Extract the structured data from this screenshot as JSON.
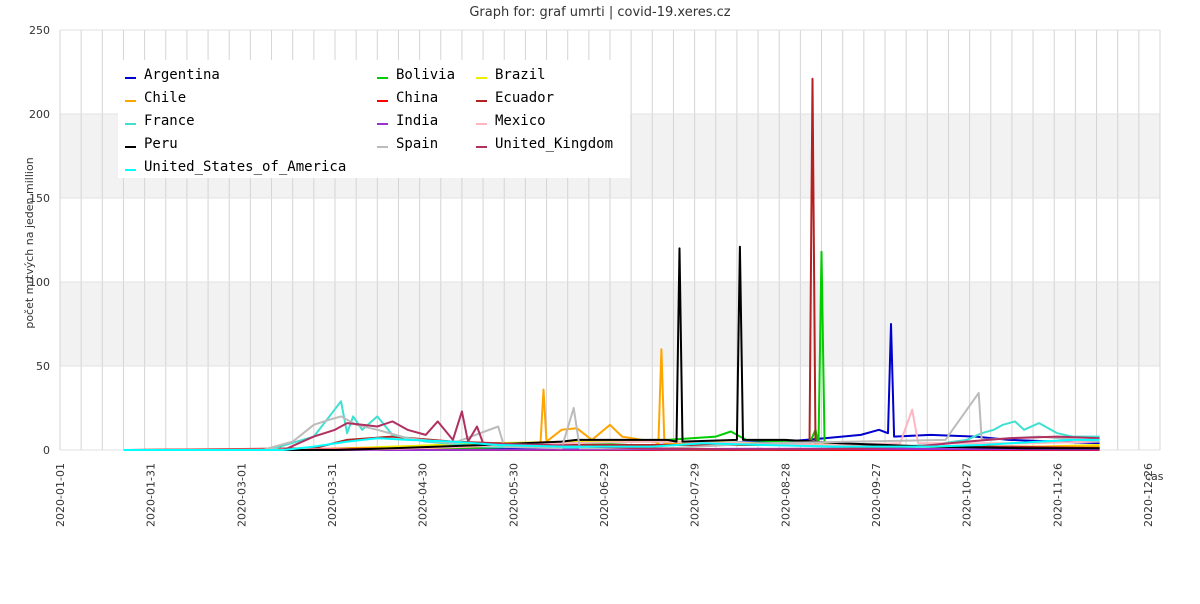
{
  "chart_data": {
    "type": "line",
    "title": "Graph for: graf umrti | covid-19.xeres.cz",
    "xlabel": "cas",
    "ylabel": "počet mrtvých na jeden million",
    "ylim": [
      0,
      250
    ],
    "xlim": [
      "2020-01-01",
      "2020-12-30"
    ],
    "grid": true,
    "legend_position": "top-left",
    "y_ticks": [
      0,
      50,
      100,
      150,
      200,
      250
    ],
    "x_ticks": [
      "2020-01-01",
      "2020-01-31",
      "2020-03-01",
      "2020-03-31",
      "2020-04-30",
      "2020-05-30",
      "2020-06-29",
      "2020-07-29",
      "2020-08-28",
      "2020-09-27",
      "2020-10-27",
      "2020-11-26",
      "2020-12-26"
    ],
    "series": [
      {
        "name": "Argentina",
        "color": "#0000cc",
        "points": [
          [
            "2020-01-22",
            0
          ],
          [
            "2020-03-09",
            0
          ],
          [
            "2020-04-01",
            0.3
          ],
          [
            "2020-05-01",
            0.5
          ],
          [
            "2020-06-01",
            1
          ],
          [
            "2020-07-01",
            2
          ],
          [
            "2020-08-01",
            4
          ],
          [
            "2020-08-28",
            5
          ],
          [
            "2020-09-10",
            7
          ],
          [
            "2020-09-22",
            9
          ],
          [
            "2020-09-28",
            12
          ],
          [
            "2020-10-01",
            10
          ],
          [
            "2020-10-02",
            75
          ],
          [
            "2020-10-03",
            8
          ],
          [
            "2020-10-15",
            9
          ],
          [
            "2020-10-30",
            8
          ],
          [
            "2020-11-10",
            6
          ],
          [
            "2020-11-26",
            5
          ],
          [
            "2020-12-10",
            4
          ]
        ]
      },
      {
        "name": "Bolivia",
        "color": "#00cc00",
        "points": [
          [
            "2020-01-22",
            0
          ],
          [
            "2020-04-01",
            0
          ],
          [
            "2020-05-15",
            1
          ],
          [
            "2020-06-20",
            3
          ],
          [
            "2020-07-20",
            6
          ],
          [
            "2020-08-05",
            8
          ],
          [
            "2020-08-10",
            11
          ],
          [
            "2020-08-15",
            6
          ],
          [
            "2020-09-05",
            4
          ],
          [
            "2020-09-07",
            12
          ],
          [
            "2020-09-08",
            3
          ],
          [
            "2020-09-09",
            118
          ],
          [
            "2020-09-10",
            3
          ],
          [
            "2020-10-15",
            2
          ],
          [
            "2020-12-10",
            1
          ]
        ]
      },
      {
        "name": "Brazil",
        "color": "#eeee00",
        "points": [
          [
            "2020-01-22",
            0
          ],
          [
            "2020-03-20",
            0
          ],
          [
            "2020-04-20",
            2
          ],
          [
            "2020-05-20",
            4
          ],
          [
            "2020-06-20",
            5
          ],
          [
            "2020-07-20",
            5
          ],
          [
            "2020-08-20",
            4
          ],
          [
            "2020-09-20",
            3
          ],
          [
            "2020-10-20",
            2
          ],
          [
            "2020-11-20",
            2
          ],
          [
            "2020-12-10",
            3
          ]
        ]
      },
      {
        "name": "Chile",
        "color": "#ffa500",
        "points": [
          [
            "2020-01-22",
            0
          ],
          [
            "2020-04-01",
            0
          ],
          [
            "2020-05-01",
            1
          ],
          [
            "2020-06-01",
            3
          ],
          [
            "2020-06-08",
            4
          ],
          [
            "2020-06-09",
            36
          ],
          [
            "2020-06-10",
            5
          ],
          [
            "2020-06-15",
            12
          ],
          [
            "2020-06-20",
            13
          ],
          [
            "2020-06-25",
            6
          ],
          [
            "2020-07-01",
            15
          ],
          [
            "2020-07-05",
            8
          ],
          [
            "2020-07-15",
            5
          ],
          [
            "2020-07-17",
            4
          ],
          [
            "2020-07-18",
            60
          ],
          [
            "2020-07-19",
            4
          ],
          [
            "2020-08-15",
            3
          ],
          [
            "2020-09-15",
            3
          ],
          [
            "2020-10-15",
            2
          ],
          [
            "2020-11-15",
            2
          ],
          [
            "2020-12-10",
            2
          ]
        ]
      },
      {
        "name": "China",
        "color": "#ff0000",
        "points": [
          [
            "2020-01-22",
            0
          ],
          [
            "2020-04-17",
            0.9
          ],
          [
            "2020-04-18",
            0
          ],
          [
            "2020-12-10",
            0
          ]
        ]
      },
      {
        "name": "Ecuador",
        "color": "#b22222",
        "points": [
          [
            "2020-01-22",
            0
          ],
          [
            "2020-03-25",
            1
          ],
          [
            "2020-04-05",
            6
          ],
          [
            "2020-04-20",
            8
          ],
          [
            "2020-05-10",
            5
          ],
          [
            "2020-06-10",
            3
          ],
          [
            "2020-07-10",
            3
          ],
          [
            "2020-08-10",
            3
          ],
          [
            "2020-09-05",
            3
          ],
          [
            "2020-09-06",
            221
          ],
          [
            "2020-09-07",
            3
          ],
          [
            "2020-10-10",
            2
          ],
          [
            "2020-11-10",
            2
          ],
          [
            "2020-12-10",
            1
          ]
        ]
      },
      {
        "name": "France",
        "color": "#40e0d0",
        "points": [
          [
            "2020-01-22",
            0
          ],
          [
            "2020-03-10",
            0
          ],
          [
            "2020-03-25",
            8
          ],
          [
            "2020-04-03",
            29
          ],
          [
            "2020-04-05",
            10
          ],
          [
            "2020-04-07",
            20
          ],
          [
            "2020-04-10",
            12
          ],
          [
            "2020-04-15",
            20
          ],
          [
            "2020-04-20",
            9
          ],
          [
            "2020-05-01",
            5
          ],
          [
            "2020-05-20",
            2
          ],
          [
            "2020-06-20",
            1
          ],
          [
            "2020-07-20",
            0.5
          ],
          [
            "2020-08-20",
            0.5
          ],
          [
            "2020-09-20",
            1
          ],
          [
            "2020-10-15",
            3
          ],
          [
            "2020-10-27",
            6
          ],
          [
            "2020-11-01",
            10
          ],
          [
            "2020-11-05",
            12
          ],
          [
            "2020-11-08",
            15
          ],
          [
            "2020-11-12",
            17
          ],
          [
            "2020-11-15",
            12
          ],
          [
            "2020-11-20",
            16
          ],
          [
            "2020-11-26",
            10
          ],
          [
            "2020-12-01",
            8
          ],
          [
            "2020-12-10",
            8
          ]
        ]
      },
      {
        "name": "India",
        "color": "#9932cc",
        "points": [
          [
            "2020-01-22",
            0
          ],
          [
            "2020-05-01",
            0
          ],
          [
            "2020-06-01",
            0.2
          ],
          [
            "2020-07-01",
            0.3
          ],
          [
            "2020-08-01",
            0.6
          ],
          [
            "2020-09-01",
            0.8
          ],
          [
            "2020-10-01",
            0.8
          ],
          [
            "2020-11-01",
            0.5
          ],
          [
            "2020-12-10",
            0.3
          ]
        ]
      },
      {
        "name": "Mexico",
        "color": "#ffb6c1",
        "points": [
          [
            "2020-01-22",
            0
          ],
          [
            "2020-04-15",
            0.5
          ],
          [
            "2020-05-15",
            2
          ],
          [
            "2020-06-15",
            4
          ],
          [
            "2020-07-15",
            5
          ],
          [
            "2020-08-15",
            4
          ],
          [
            "2020-09-15",
            3
          ],
          [
            "2020-10-05",
            4
          ],
          [
            "2020-10-09",
            24
          ],
          [
            "2020-10-11",
            4
          ],
          [
            "2020-11-15",
            4
          ],
          [
            "2020-12-10",
            5
          ]
        ]
      },
      {
        "name": "Peru",
        "color": "#000000",
        "points": [
          [
            "2020-01-22",
            0
          ],
          [
            "2020-04-01",
            0
          ],
          [
            "2020-04-20",
            1
          ],
          [
            "2020-05-20",
            3
          ],
          [
            "2020-06-15",
            5
          ],
          [
            "2020-06-20",
            6
          ],
          [
            "2020-07-20",
            6
          ],
          [
            "2020-07-23",
            5
          ],
          [
            "2020-07-24",
            120
          ],
          [
            "2020-07-25",
            5
          ],
          [
            "2020-08-12",
            6
          ],
          [
            "2020-08-13",
            121
          ],
          [
            "2020-08-14",
            6
          ],
          [
            "2020-08-28",
            6
          ],
          [
            "2020-09-15",
            4
          ],
          [
            "2020-10-15",
            2
          ],
          [
            "2020-11-15",
            1
          ],
          [
            "2020-12-10",
            1
          ]
        ]
      },
      {
        "name": "Spain",
        "color": "#bbbbbb",
        "points": [
          [
            "2020-01-22",
            0
          ],
          [
            "2020-03-08",
            0
          ],
          [
            "2020-03-18",
            5
          ],
          [
            "2020-03-25",
            15
          ],
          [
            "2020-03-30",
            18
          ],
          [
            "2020-04-03",
            20
          ],
          [
            "2020-04-08",
            15
          ],
          [
            "2020-04-15",
            12
          ],
          [
            "2020-04-25",
            7
          ],
          [
            "2020-05-10",
            4
          ],
          [
            "2020-05-25",
            14
          ],
          [
            "2020-05-27",
            2
          ],
          [
            "2020-06-15",
            1
          ],
          [
            "2020-06-19",
            25
          ],
          [
            "2020-06-21",
            1
          ],
          [
            "2020-07-20",
            1
          ],
          [
            "2020-08-20",
            4
          ],
          [
            "2020-09-20",
            5
          ],
          [
            "2020-10-20",
            6
          ],
          [
            "2020-10-31",
            34
          ],
          [
            "2020-11-01",
            6
          ],
          [
            "2020-11-20",
            8
          ],
          [
            "2020-12-10",
            5
          ]
        ]
      },
      {
        "name": "United_Kingdom",
        "color": "#b03060",
        "points": [
          [
            "2020-01-22",
            0
          ],
          [
            "2020-03-15",
            0
          ],
          [
            "2020-03-25",
            8
          ],
          [
            "2020-04-01",
            12
          ],
          [
            "2020-04-05",
            16
          ],
          [
            "2020-04-10",
            15
          ],
          [
            "2020-04-15",
            14
          ],
          [
            "2020-04-20",
            17
          ],
          [
            "2020-04-25",
            12
          ],
          [
            "2020-05-01",
            9
          ],
          [
            "2020-05-05",
            17
          ],
          [
            "2020-05-10",
            6
          ],
          [
            "2020-05-13",
            23
          ],
          [
            "2020-05-15",
            5
          ],
          [
            "2020-05-18",
            14
          ],
          [
            "2020-05-20",
            4
          ],
          [
            "2020-06-10",
            3
          ],
          [
            "2020-07-10",
            1
          ],
          [
            "2020-08-10",
            0.3
          ],
          [
            "2020-09-10",
            0.5
          ],
          [
            "2020-10-10",
            2
          ],
          [
            "2020-10-27",
            5
          ],
          [
            "2020-11-10",
            7
          ],
          [
            "2020-11-26",
            8
          ],
          [
            "2020-12-10",
            7
          ]
        ]
      },
      {
        "name": "United_States_of_America",
        "color": "#00ffff",
        "points": [
          [
            "2020-01-22",
            0
          ],
          [
            "2020-03-15",
            0
          ],
          [
            "2020-03-25",
            2
          ],
          [
            "2020-04-05",
            5
          ],
          [
            "2020-04-15",
            7
          ],
          [
            "2020-04-25",
            6
          ],
          [
            "2020-05-10",
            5
          ],
          [
            "2020-05-25",
            3
          ],
          [
            "2020-06-15",
            2
          ],
          [
            "2020-07-15",
            2
          ],
          [
            "2020-08-01",
            4
          ],
          [
            "2020-08-20",
            3
          ],
          [
            "2020-09-15",
            2
          ],
          [
            "2020-10-15",
            2
          ],
          [
            "2020-11-01",
            3
          ],
          [
            "2020-11-20",
            5
          ],
          [
            "2020-12-01",
            6
          ],
          [
            "2020-12-10",
            6
          ]
        ]
      }
    ]
  }
}
